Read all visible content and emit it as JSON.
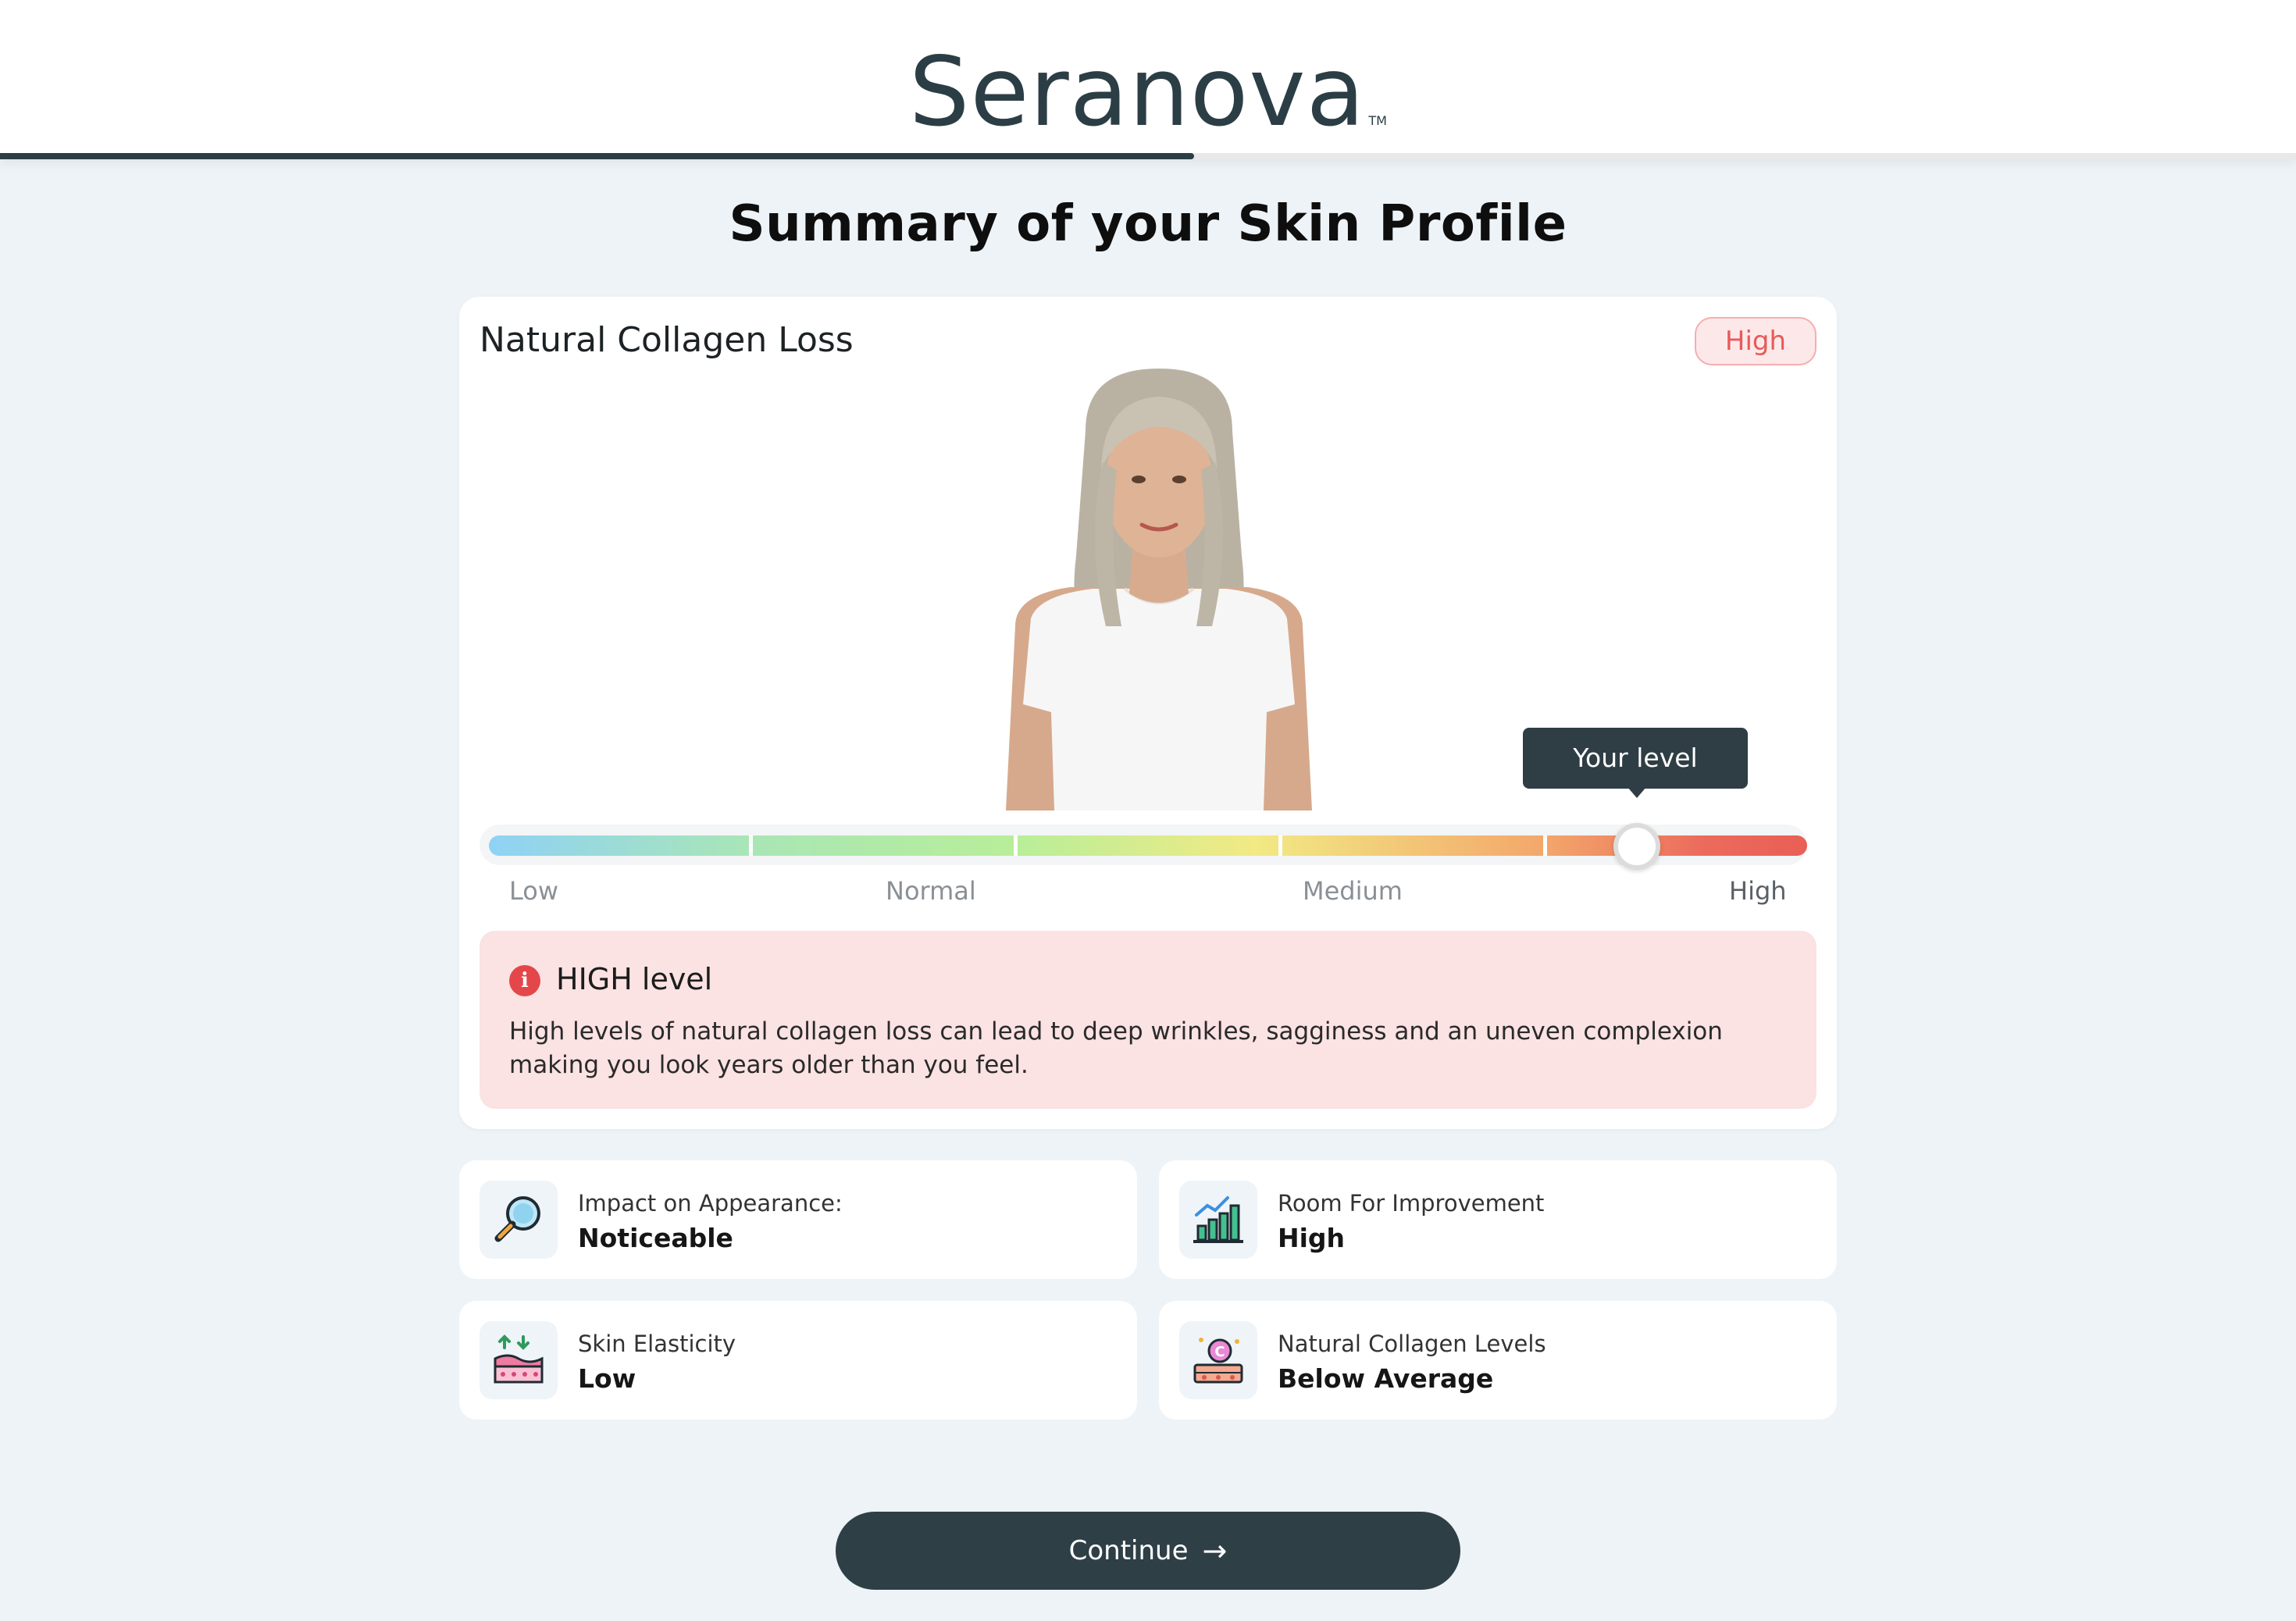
{
  "brand": {
    "name": "Seranova",
    "trademark": "TM"
  },
  "progress": {
    "fraction": 0.52
  },
  "page": {
    "title": "Summary of your Skin Profile"
  },
  "profile": {
    "card_title": "Natural Collagen Loss",
    "badge": "High",
    "tooltip": "Your level",
    "scale": {
      "labels": [
        "Low",
        "Normal",
        "Medium",
        "High"
      ],
      "selected": "High",
      "position": 0.87
    },
    "alert": {
      "title": "HIGH level",
      "text": "High levels of natural collagen loss can lead to deep wrinkles, sagginess and an uneven complexion making you look years older than you feel."
    }
  },
  "stats": [
    {
      "label": "Impact on Appearance:",
      "value": "Noticeable",
      "icon": "magnifier-icon"
    },
    {
      "label": "Room For Improvement",
      "value": "High",
      "icon": "growth-chart-icon"
    },
    {
      "label": "Skin Elasticity",
      "value": "Low",
      "icon": "skin-layers-icon"
    },
    {
      "label": "Natural Collagen Levels",
      "value": "Below Average",
      "icon": "collagen-icon"
    }
  ],
  "cta": {
    "label": "Continue",
    "icon": "arrow-right-icon"
  },
  "colors": {
    "dark": "#2e3f46",
    "alert_bg": "#fbe2e3",
    "alert_icon": "#e4474a",
    "badge_text": "#e65a5a",
    "page_bg": "#edf3f7"
  }
}
